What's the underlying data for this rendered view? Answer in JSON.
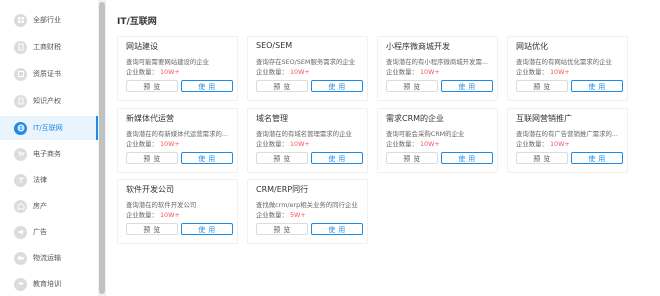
{
  "sidebar": {
    "items": [
      {
        "label": "全部行业",
        "icon": "grid-icon"
      },
      {
        "label": "工商财税",
        "icon": "tax-icon"
      },
      {
        "label": "资质证书",
        "icon": "certificate-icon"
      },
      {
        "label": "知识产权",
        "icon": "ip-icon"
      },
      {
        "label": "IT/互联网",
        "icon": "globe-icon",
        "active": true
      },
      {
        "label": "电子商务",
        "icon": "cart-icon"
      },
      {
        "label": "法律",
        "icon": "law-icon"
      },
      {
        "label": "房产",
        "icon": "house-icon"
      },
      {
        "label": "广告",
        "icon": "ad-icon"
      },
      {
        "label": "物流运输",
        "icon": "truck-icon"
      },
      {
        "label": "教育培训",
        "icon": "education-icon"
      }
    ]
  },
  "main": {
    "title": "IT/互联网",
    "count_label": "企业数量：",
    "preview_label": "预 览",
    "use_label": "使 用",
    "cards": [
      {
        "title": "网站建设",
        "desc": "查询可能需要网站建设的企业",
        "count": "10W+"
      },
      {
        "title": "SEO/SEM",
        "desc": "查询存在SEO/SEM服务需求的企业",
        "count": "10W+"
      },
      {
        "title": "小程序微商城开发",
        "desc": "查询潜在的有小程序微商城开发需...",
        "count": "10W+"
      },
      {
        "title": "网站优化",
        "desc": "查询潜在的有网站优化需求的企业",
        "count": "10W+"
      },
      {
        "title": "新媒体代运营",
        "desc": "查询潜在的有新媒体代运营需求的...",
        "count": "10W+"
      },
      {
        "title": "域名管理",
        "desc": "查询潜在的有域名管理需求的企业",
        "count": "10W+"
      },
      {
        "title": "需求CRM的企业",
        "desc": "查询可能会采购CRM的企业",
        "count": "10W+"
      },
      {
        "title": "互联网营销推广",
        "desc": "查询潜在的有广告营销推广需求的...",
        "count": "10W+"
      },
      {
        "title": "软件开发公司",
        "desc": "查询潜在的软件开发公司",
        "count": "10W+"
      },
      {
        "title": "CRM/ERP同行",
        "desc": "查找做crm/erp相关业务的同行企业",
        "count": "5W+"
      }
    ]
  }
}
